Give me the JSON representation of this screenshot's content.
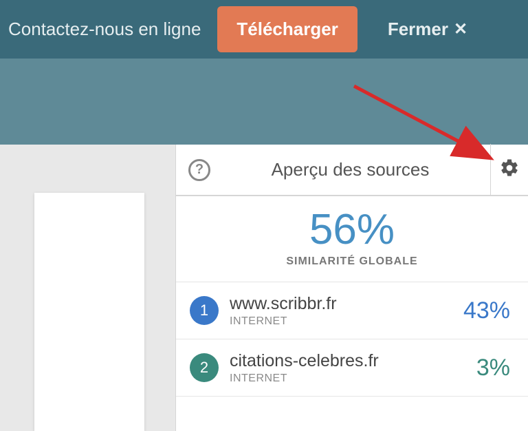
{
  "topbar": {
    "contact_label": "Contactez-nous en ligne",
    "download_label": "Télécharger",
    "close_label": "Fermer"
  },
  "panel": {
    "title": "Aperçu des sources",
    "similarity_value": "56%",
    "similarity_label": "SIMILARITÉ GLOBALE"
  },
  "sources": [
    {
      "num": "1",
      "domain": "www.scribbr.fr",
      "type": "INTERNET",
      "pct": "43%",
      "badge_color": "#3a78c9",
      "pct_color": "#3a78c9"
    },
    {
      "num": "2",
      "domain": "citations-celebres.fr",
      "type": "INTERNET",
      "pct": "3%",
      "badge_color": "#3a8a7d",
      "pct_color": "#3a8a7d"
    }
  ]
}
